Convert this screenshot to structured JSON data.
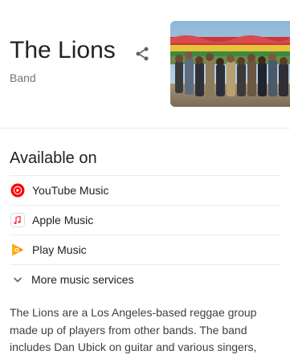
{
  "entity": {
    "title": "The Lions",
    "subtitle": "Band"
  },
  "share": {
    "icon": "share-icon"
  },
  "available": {
    "heading": "Available on",
    "services": [
      {
        "label": "YouTube Music",
        "icon": "youtube-music-icon",
        "color": "#ff0000"
      },
      {
        "label": "Apple Music",
        "icon": "apple-music-icon",
        "color": "#fa2d48"
      },
      {
        "label": "Play Music",
        "icon": "play-music-icon",
        "color": "#ff8f00"
      }
    ],
    "more_label": "More music services"
  },
  "description": "The Lions are a Los Angeles-based reggae group made up of players from other bands. The band includes Dan Ubick on guitar and various singers,"
}
